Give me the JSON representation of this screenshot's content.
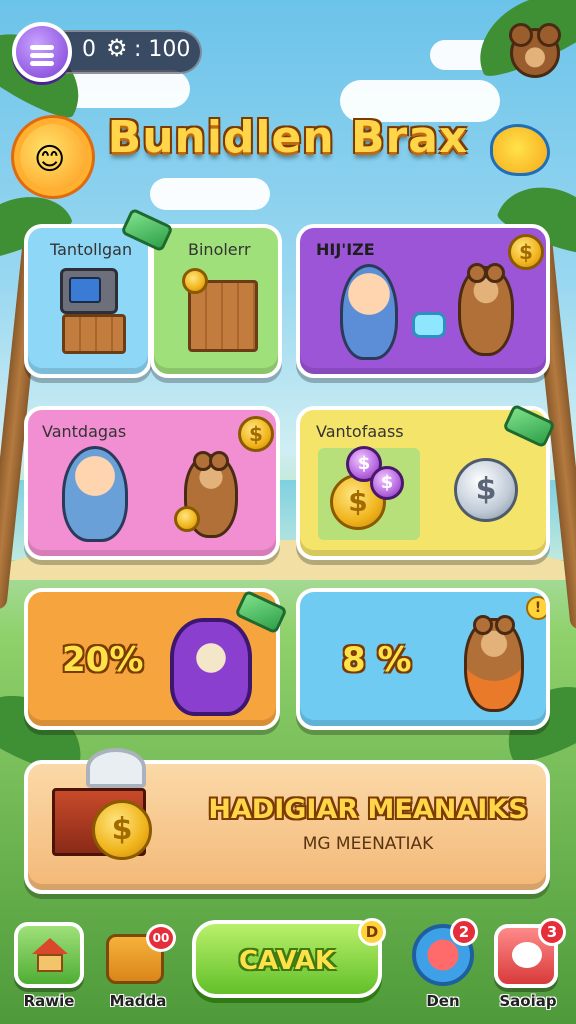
{
  "hud": {
    "currency_left": "0",
    "gear_symbol": "⚙",
    "currency_right": ": 100",
    "menu_icon": "menu-icon",
    "mascot_icon": "bear-face-icon"
  },
  "title": "Bunidlen Brax",
  "cards": [
    {
      "id": "card-1",
      "labels": [
        "Tantollgan",
        "Binolerr"
      ],
      "color": "#8fd7f7"
    },
    {
      "id": "card-2",
      "labels": [
        "HIJ'IZE"
      ],
      "color": "#9b55d6"
    },
    {
      "id": "card-3",
      "labels": [
        "Vantdagas"
      ],
      "color": "#f28fd2"
    },
    {
      "id": "card-4",
      "labels": [
        "Vantofaass"
      ],
      "color": "#f4e46a"
    },
    {
      "id": "card-5",
      "labels": [
        "20%"
      ],
      "color": "#f6a43e"
    },
    {
      "id": "card-6",
      "labels": [
        "8 %"
      ],
      "color": "#6fcbf2"
    }
  ],
  "coin_symbol": "$",
  "banner": {
    "title": "HADIGIAR MEANAIKS",
    "subtitle": "MG MEENATIAK",
    "color": "#f7c98d"
  },
  "nav": {
    "home_label": "Rawie",
    "madda_label": "Madda",
    "madda_badge": "00",
    "cta_label": "CAVAK",
    "cta_badge": "D",
    "den_label": "Den",
    "den_badge": "2",
    "chat_label": "Saoiap",
    "chat_badge": "3"
  }
}
